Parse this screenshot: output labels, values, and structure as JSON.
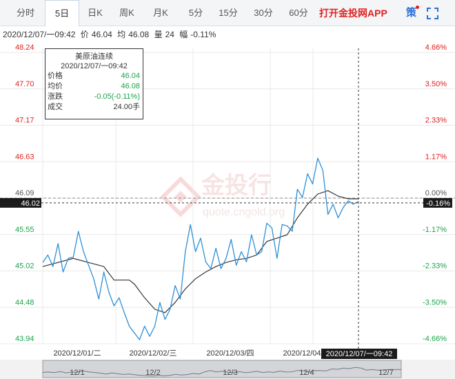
{
  "tabs": [
    {
      "label": "分时",
      "active": false
    },
    {
      "label": "5日",
      "active": true
    },
    {
      "label": "日K",
      "active": false
    },
    {
      "label": "周K",
      "active": false
    },
    {
      "label": "月K",
      "active": false
    },
    {
      "label": "5分",
      "active": false
    },
    {
      "label": "15分",
      "active": false
    },
    {
      "label": "30分",
      "active": false
    },
    {
      "label": "60分",
      "active": false
    }
  ],
  "promo_label": "打开金投网APP",
  "strategy_label": "策",
  "info": {
    "time": "2020/12/07/一09:42",
    "price_label": "价",
    "price": "46.04",
    "avg_label": "均",
    "avg": "46.08",
    "vol_label": "量",
    "vol": "24",
    "range_label": "幅",
    "range": "-0.11%"
  },
  "tooltip": {
    "title": "美原油连续",
    "time": "2020/12/07/一09:42",
    "rows": [
      {
        "label": "价格",
        "value": "46.04"
      },
      {
        "label": "均价",
        "value": "46.08"
      },
      {
        "label": "涨跌",
        "value": "-0.05(-0.11%)"
      },
      {
        "label": "成交",
        "value": "24.00手"
      }
    ]
  },
  "watermark": {
    "brand": "金投行",
    "url": "quote.cngold.org"
  },
  "colors": {
    "price_line": "#2c8fd6",
    "avg_line": "#333333",
    "up": "#e02020",
    "down": "#1aa34a",
    "accent": "#2a6fd6"
  },
  "chart_data": {
    "type": "line",
    "series": [
      {
        "name": "价格",
        "color": "#2c8fd6"
      },
      {
        "name": "均价",
        "color": "#333333"
      }
    ],
    "ylim": [
      43.94,
      48.24
    ],
    "reference_price": 46.09,
    "current_price": 46.02,
    "current_pct": "-0.16%",
    "left_ticks": [
      "48.24",
      "47.70",
      "47.17",
      "46.63",
      "46.09",
      "45.55",
      "45.02",
      "44.48",
      "43.94"
    ],
    "right_ticks": [
      "4.66%",
      "3.50%",
      "2.33%",
      "1.17%",
      "0.00%",
      "-1.17%",
      "-2.33%",
      "-3.50%",
      "-4.66%"
    ],
    "x_day_labels": [
      "2020/12/01/二",
      "2020/12/02/三",
      "2020/12/03/四",
      "2020/12/04/五",
      "2020/12/07/一"
    ],
    "crosshair_time": "2020/12/07/一09:42",
    "navigator_labels": [
      "12/1",
      "12/2",
      "12/3",
      "12/4",
      "12/7"
    ],
    "price_points": [
      [
        0,
        45.14
      ],
      [
        1,
        45.25
      ],
      [
        2,
        45.08
      ],
      [
        3,
        45.42
      ],
      [
        4,
        45.0
      ],
      [
        5,
        45.2
      ],
      [
        6,
        45.22
      ],
      [
        7,
        45.6
      ],
      [
        8,
        45.3
      ],
      [
        9,
        45.1
      ],
      [
        10,
        44.9
      ],
      [
        11,
        44.6
      ],
      [
        12,
        45.0
      ],
      [
        13,
        44.7
      ],
      [
        14,
        44.5
      ],
      [
        15,
        44.62
      ],
      [
        16,
        44.4
      ],
      [
        17,
        44.2
      ],
      [
        18,
        44.1
      ],
      [
        19,
        44.0
      ],
      [
        20,
        44.2
      ],
      [
        21,
        44.05
      ],
      [
        22,
        44.2
      ],
      [
        23,
        44.55
      ],
      [
        24,
        44.3
      ],
      [
        25,
        44.45
      ],
      [
        26,
        44.8
      ],
      [
        27,
        44.6
      ],
      [
        28,
        45.3
      ],
      [
        29,
        45.7
      ],
      [
        30,
        45.3
      ],
      [
        31,
        45.5
      ],
      [
        32,
        45.15
      ],
      [
        33,
        45.05
      ],
      [
        34,
        45.35
      ],
      [
        35,
        45.05
      ],
      [
        36,
        45.2
      ],
      [
        37,
        45.48
      ],
      [
        38,
        45.1
      ],
      [
        39,
        45.3
      ],
      [
        40,
        45.15
      ],
      [
        41,
        45.55
      ],
      [
        42,
        45.25
      ],
      [
        43,
        45.3
      ],
      [
        44,
        45.72
      ],
      [
        45,
        45.65
      ],
      [
        46,
        45.2
      ],
      [
        47,
        45.7
      ],
      [
        48,
        45.68
      ],
      [
        49,
        45.6
      ],
      [
        50,
        46.22
      ],
      [
        51,
        46.1
      ],
      [
        52,
        46.45
      ],
      [
        53,
        46.3
      ],
      [
        54,
        46.68
      ],
      [
        55,
        46.5
      ],
      [
        56,
        45.85
      ],
      [
        57,
        46.0
      ],
      [
        58,
        45.8
      ],
      [
        59,
        45.95
      ],
      [
        60,
        46.05
      ],
      [
        61,
        46.0
      ],
      [
        62,
        46.04
      ]
    ],
    "avg_points": [
      [
        0,
        45.08
      ],
      [
        6,
        45.2
      ],
      [
        12,
        45.08
      ],
      [
        14,
        44.88
      ],
      [
        17,
        44.88
      ],
      [
        18,
        44.82
      ],
      [
        20,
        44.62
      ],
      [
        22,
        44.45
      ],
      [
        24,
        44.4
      ],
      [
        26,
        44.55
      ],
      [
        28,
        44.75
      ],
      [
        30,
        44.9
      ],
      [
        32,
        45.0
      ],
      [
        34,
        45.08
      ],
      [
        36,
        45.14
      ],
      [
        38,
        45.18
      ],
      [
        40,
        45.2
      ],
      [
        42,
        45.25
      ],
      [
        44,
        45.45
      ],
      [
        46,
        45.5
      ],
      [
        48,
        45.55
      ],
      [
        50,
        45.8
      ],
      [
        52,
        46.0
      ],
      [
        54,
        46.15
      ],
      [
        56,
        46.2
      ],
      [
        58,
        46.12
      ],
      [
        60,
        46.08
      ],
      [
        62,
        46.08
      ]
    ]
  }
}
